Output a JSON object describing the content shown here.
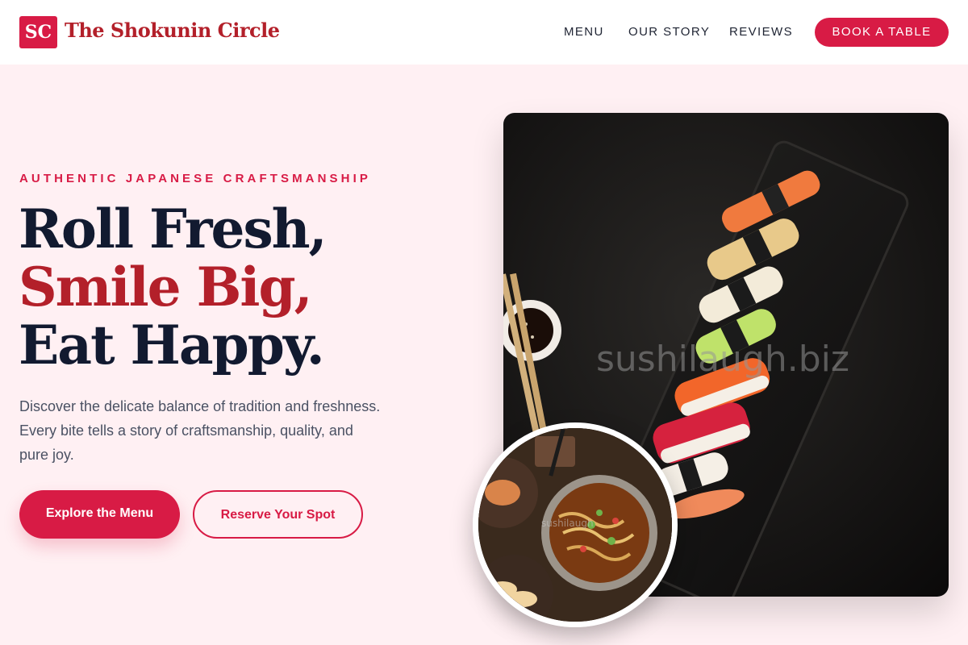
{
  "header": {
    "logo_initials": "SC",
    "brand_name": "The Shokunin Circle",
    "nav": {
      "menu": "MENU",
      "our_story": "OUR STORY",
      "reviews": "REVIEWS"
    },
    "cta": "BOOK A TABLE"
  },
  "hero": {
    "eyebrow": "AUTHENTIC JAPANESE CRAFTSMANSHIP",
    "headline": [
      "Roll Fresh,",
      "Smile Big,",
      "Eat Happy."
    ],
    "description": "Discover the delicate balance of tradition and freshness. Every bite tells a story of craftsmanship, quality, and pure joy.",
    "primary_button": "Explore the Menu",
    "secondary_button": "Reserve Your Spot",
    "image_watermark": "sushilaugh.biz",
    "inset_watermark": "sushilaugh"
  },
  "colors": {
    "accent": "#d81b45",
    "brand_red": "#b3202a",
    "headline_dark": "#121a30",
    "page_background": "#fff0f3"
  }
}
